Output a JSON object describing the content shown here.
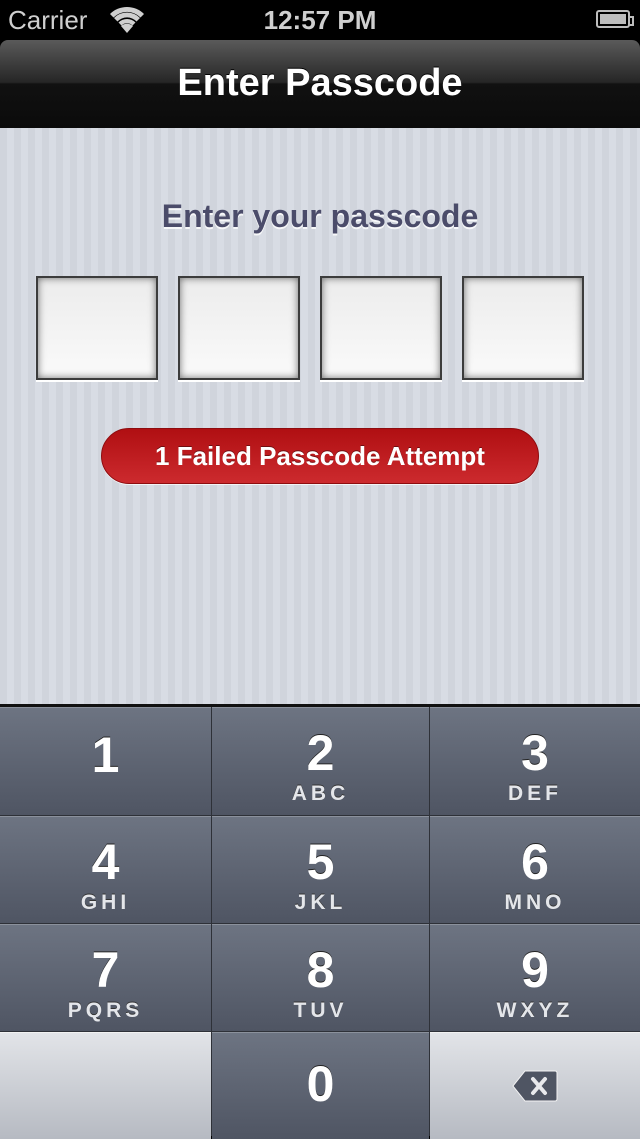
{
  "status_bar": {
    "carrier": "Carrier",
    "time": "12:57 PM",
    "wifi_icon": "wifi-icon",
    "battery_icon": "battery-icon",
    "battery_level": 1.0
  },
  "navbar": {
    "title": "Enter Passcode"
  },
  "passcode": {
    "prompt": "Enter your passcode",
    "fields": [
      "",
      "",
      "",
      ""
    ],
    "failed_attempts_label": "1 Failed Passcode Attempt",
    "alert_color": "#c01a1e"
  },
  "keypad": {
    "keys": [
      {
        "digit": "1",
        "letters": ""
      },
      {
        "digit": "2",
        "letters": "ABC"
      },
      {
        "digit": "3",
        "letters": "DEF"
      },
      {
        "digit": "4",
        "letters": "GHI"
      },
      {
        "digit": "5",
        "letters": "JKL"
      },
      {
        "digit": "6",
        "letters": "MNO"
      },
      {
        "digit": "7",
        "letters": "PQRS"
      },
      {
        "digit": "8",
        "letters": "TUV"
      },
      {
        "digit": "9",
        "letters": "WXYZ"
      },
      {
        "digit": "0",
        "letters": ""
      }
    ],
    "delete_icon": "backspace-icon"
  }
}
